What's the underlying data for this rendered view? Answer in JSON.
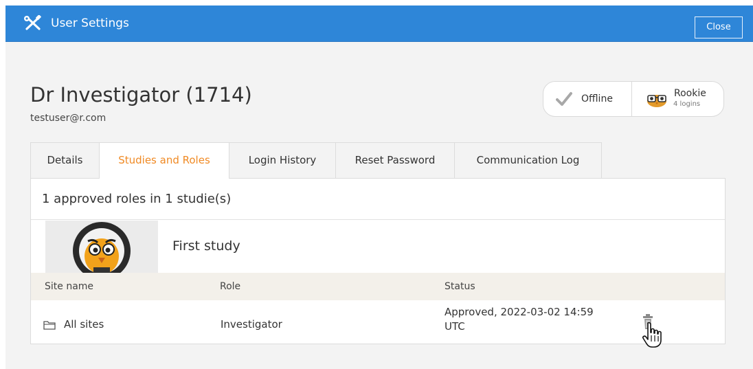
{
  "window": {
    "title": "User Settings",
    "close_label": "Close"
  },
  "user": {
    "name": "Dr Investigator (1714)",
    "email": "testuser@r.com"
  },
  "status": {
    "online_label": "Offline",
    "level_label": "Rookie",
    "logins_label": "4 logins"
  },
  "tabs": [
    {
      "label": "Details",
      "active": false
    },
    {
      "label": "Studies and Roles",
      "active": true
    },
    {
      "label": "Login History",
      "active": false
    },
    {
      "label": "Reset Password",
      "active": false
    },
    {
      "label": "Communication Log",
      "active": false
    }
  ],
  "studies": {
    "summary": "1 approved roles in 1 studie(s)",
    "study_name": "First study",
    "columns": [
      "Site name",
      "Role",
      "Status"
    ],
    "rows": [
      {
        "site": "All sites",
        "role": "Investigator",
        "status_line1": "Approved, 2022-03-02 14:59",
        "status_line2": "UTC"
      }
    ]
  },
  "colors": {
    "titlebar": "#2e86d8",
    "active_tab": "#f08a24",
    "table_header": "#f3f0ea"
  },
  "icons": [
    "tools-icon",
    "checkmark-icon",
    "owl-avatar-icon",
    "study-logo",
    "folder-icon",
    "trash-icon",
    "hand-cursor-icon"
  ]
}
